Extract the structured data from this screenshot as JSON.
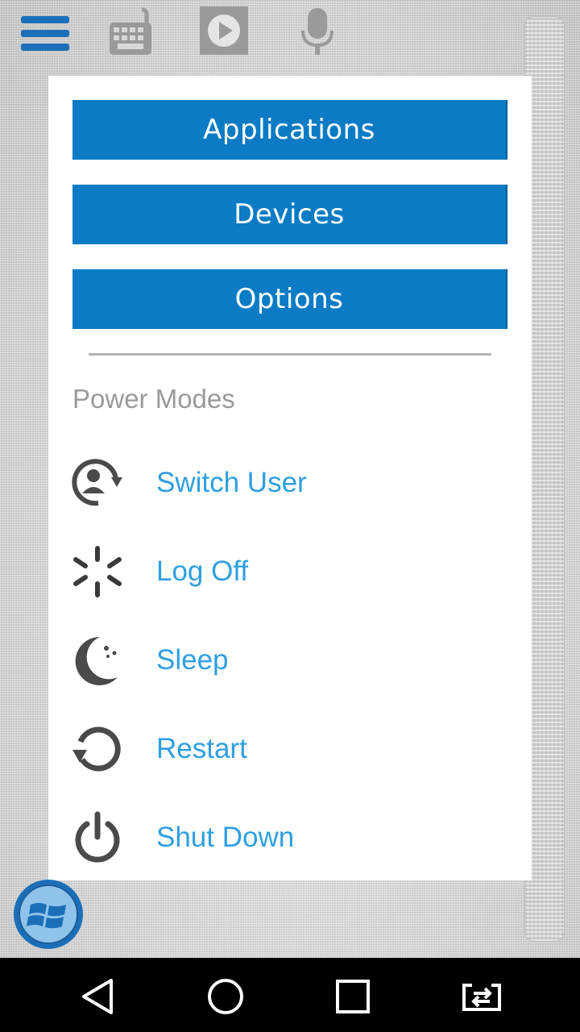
{
  "toolbar": {
    "menu_icon": "hamburger-menu-icon",
    "keyboard_icon": "keyboard-icon",
    "play_icon": "play-icon",
    "mic_icon": "microphone-icon",
    "accent_color": "#1a6fb8"
  },
  "menu": {
    "buttons": [
      {
        "label": "Applications"
      },
      {
        "label": "Devices"
      },
      {
        "label": "Options"
      }
    ],
    "button_color": "#0a7bc4"
  },
  "power": {
    "title": "Power Modes",
    "label_color": "#2f9fe0",
    "items": [
      {
        "label": "Switch User",
        "icon": "switch-user-icon"
      },
      {
        "label": "Log Off",
        "icon": "log-off-icon"
      },
      {
        "label": "Sleep",
        "icon": "sleep-moon-icon"
      },
      {
        "label": "Restart",
        "icon": "restart-icon"
      },
      {
        "label": "Shut Down",
        "icon": "power-icon"
      }
    ]
  },
  "start_orb": {
    "icon": "windows-start-icon"
  },
  "navbar": {
    "back_icon": "back-triangle-icon",
    "home_icon": "home-circle-icon",
    "recents_icon": "recents-square-icon",
    "switch_icon": "switch-app-icon"
  }
}
